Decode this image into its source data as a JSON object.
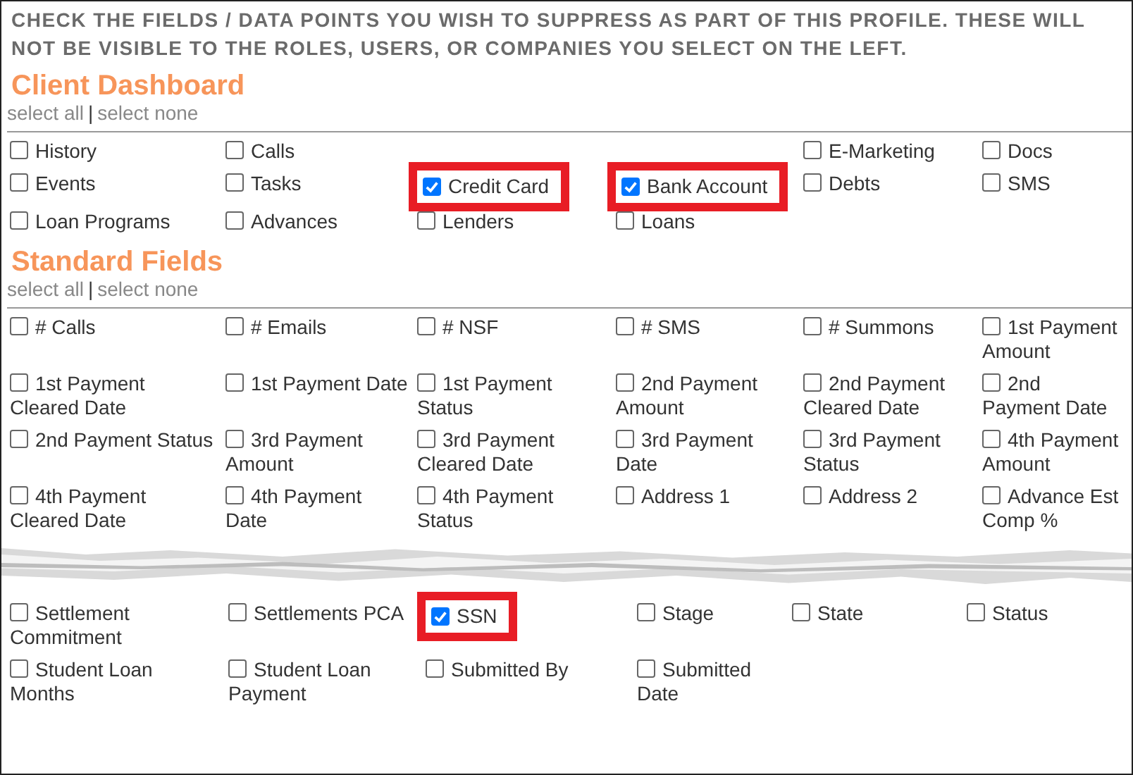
{
  "instructions": "CHECK THE FIELDS / DATA POINTS YOU WISH TO SUPPRESS AS PART OF THIS PROFILE. THESE WILL NOT BE VISIBLE TO THE ROLES, USERS, OR COMPANIES YOU SELECT ON THE LEFT.",
  "sections": [
    {
      "title": "Client Dashboard",
      "select_all": "select all",
      "separator": "|",
      "select_none": "select none",
      "groups": [
        {
          "kind": "grid",
          "items": [
            {
              "kind": "option",
              "label": "History",
              "checked": false,
              "highlighted": false
            },
            {
              "kind": "option",
              "label": "Calls",
              "checked": false,
              "highlighted": false
            },
            {
              "kind": "gap"
            },
            {
              "kind": "gap"
            },
            {
              "kind": "option",
              "label": "E-Marketing",
              "checked": false,
              "highlighted": false
            },
            {
              "kind": "option",
              "label": "Docs",
              "checked": false,
              "highlighted": false
            },
            {
              "kind": "option",
              "label": "Events",
              "checked": false,
              "highlighted": false
            },
            {
              "kind": "option",
              "label": "Tasks",
              "checked": false,
              "highlighted": false
            },
            {
              "kind": "option",
              "label": "Credit Card",
              "checked": true,
              "highlighted": true
            },
            {
              "kind": "option",
              "label": "Bank Account",
              "checked": true,
              "highlighted": true
            },
            {
              "kind": "option",
              "label": "Debts",
              "checked": false,
              "highlighted": false
            },
            {
              "kind": "option",
              "label": "SMS",
              "checked": false,
              "highlighted": false
            },
            {
              "kind": "option",
              "label": "Loan Programs",
              "checked": false,
              "highlighted": false
            },
            {
              "kind": "option",
              "label": "Advances",
              "checked": false,
              "highlighted": false
            },
            {
              "kind": "option",
              "label": "Lenders",
              "checked": false,
              "highlighted": false
            },
            {
              "kind": "option",
              "label": "Loans",
              "checked": false,
              "highlighted": false
            }
          ]
        }
      ]
    },
    {
      "title": "Standard Fields",
      "select_all": "select all",
      "separator": "|",
      "select_none": "select none",
      "groups": [
        {
          "kind": "grid",
          "items": [
            {
              "kind": "option",
              "label": "# Calls",
              "checked": false,
              "highlighted": false
            },
            {
              "kind": "option",
              "label": "# Emails",
              "checked": false,
              "highlighted": false
            },
            {
              "kind": "option",
              "label": "# NSF",
              "checked": false,
              "highlighted": false
            },
            {
              "kind": "option",
              "label": "# SMS",
              "checked": false,
              "highlighted": false
            },
            {
              "kind": "option",
              "label": "# Summons",
              "checked": false,
              "highlighted": false
            },
            {
              "kind": "option",
              "label": "1st Payment Amount",
              "checked": false,
              "highlighted": false
            },
            {
              "kind": "option",
              "label": "1st Payment Cleared Date",
              "checked": false,
              "highlighted": false
            },
            {
              "kind": "option",
              "label": "1st Payment Date",
              "checked": false,
              "highlighted": false
            },
            {
              "kind": "option",
              "label": "1st Payment Status",
              "checked": false,
              "highlighted": false
            },
            {
              "kind": "option",
              "label": "2nd Payment Amount",
              "checked": false,
              "highlighted": false
            },
            {
              "kind": "option",
              "label": "2nd Payment Cleared Date",
              "checked": false,
              "highlighted": false
            },
            {
              "kind": "option",
              "label": "2nd Payment Date",
              "checked": false,
              "highlighted": false
            },
            {
              "kind": "option",
              "label": "2nd Payment Status",
              "checked": false,
              "highlighted": false
            },
            {
              "kind": "option",
              "label": "3rd Payment Amount",
              "checked": false,
              "highlighted": false
            },
            {
              "kind": "option",
              "label": "3rd Payment Cleared Date",
              "checked": false,
              "highlighted": false
            },
            {
              "kind": "option",
              "label": "3rd Payment Date",
              "checked": false,
              "highlighted": false
            },
            {
              "kind": "option",
              "label": "3rd Payment Status",
              "checked": false,
              "highlighted": false
            },
            {
              "kind": "option",
              "label": "4th Payment Amount",
              "checked": false,
              "highlighted": false
            },
            {
              "kind": "option",
              "label": "4th Payment Cleared Date",
              "checked": false,
              "highlighted": false
            },
            {
              "kind": "option",
              "label": "4th Payment Date",
              "checked": false,
              "highlighted": false
            },
            {
              "kind": "option",
              "label": "4th Payment Status",
              "checked": false,
              "highlighted": false
            },
            {
              "kind": "option",
              "label": "Address 1",
              "checked": false,
              "highlighted": false
            },
            {
              "kind": "option",
              "label": "Address 2",
              "checked": false,
              "highlighted": false
            },
            {
              "kind": "option",
              "label": "Advance Est Comp %",
              "checked": false,
              "highlighted": false
            }
          ]
        },
        {
          "kind": "tear"
        },
        {
          "kind": "grid",
          "items": [
            {
              "kind": "option",
              "label": "Settlement Commitment",
              "checked": false,
              "highlighted": false
            },
            {
              "kind": "option",
              "label": "Settlements PCA",
              "checked": false,
              "highlighted": false
            },
            {
              "kind": "option",
              "label": "SSN",
              "checked": true,
              "highlighted": true
            },
            {
              "kind": "option",
              "label": "Stage",
              "checked": false,
              "highlighted": false
            },
            {
              "kind": "option",
              "label": "State",
              "checked": false,
              "highlighted": false
            },
            {
              "kind": "option",
              "label": "Status",
              "checked": false,
              "highlighted": false
            },
            {
              "kind": "option",
              "label": "Student Loan Months",
              "checked": false,
              "highlighted": false
            },
            {
              "kind": "option",
              "label": "Student Loan Payment",
              "checked": false,
              "highlighted": false
            },
            {
              "kind": "option",
              "label": "Submitted By",
              "checked": false,
              "highlighted": false
            },
            {
              "kind": "option",
              "label": "Submitted Date",
              "checked": false,
              "highlighted": false
            }
          ]
        }
      ]
    }
  ]
}
